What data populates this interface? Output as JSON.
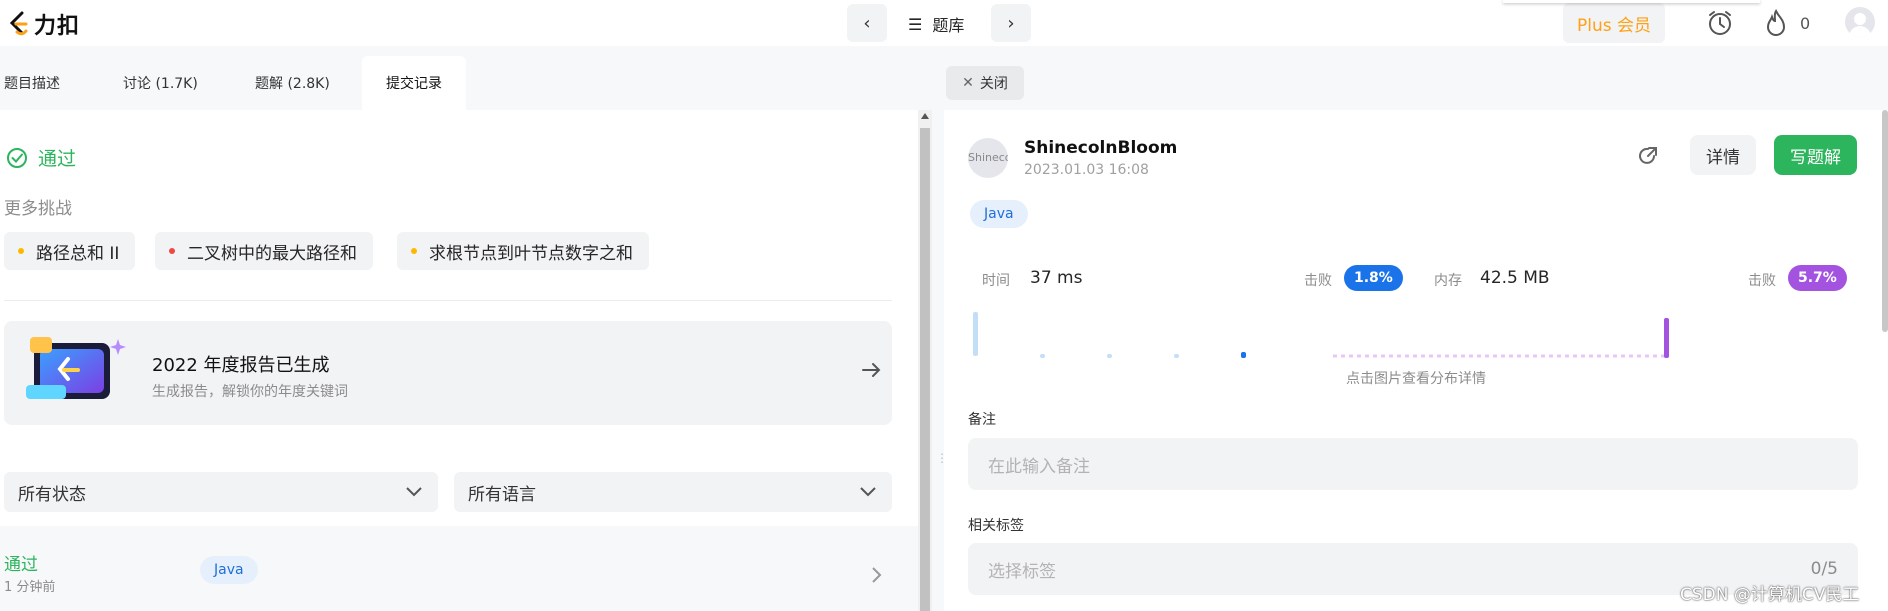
{
  "app": {
    "logo_text": "力扣"
  },
  "header": {
    "bank_label": "题库",
    "plus_label": "Plus 会员",
    "streak_count": "0"
  },
  "tabs": [
    {
      "label": "题目描述"
    },
    {
      "label": "讨论 (1.7K)"
    },
    {
      "label": "题解 (2.8K)"
    },
    {
      "label": "提交记录"
    }
  ],
  "result": {
    "status": "通过"
  },
  "challenges": {
    "title": "更多挑战",
    "items": [
      {
        "label": "路径总和 II",
        "color": "#ffb800"
      },
      {
        "label": "二叉树中的最大路径和",
        "color": "#ef4743"
      },
      {
        "label": "求根节点到叶节点数字之和",
        "color": "#ffb800"
      }
    ]
  },
  "report": {
    "title": "2022 年度报告已生成",
    "subtitle": "生成报告，解锁你的年度关键词"
  },
  "filters": {
    "status": "所有状态",
    "language": "所有语言"
  },
  "submission": {
    "status": "通过",
    "time": "1 分钟前",
    "language": "Java"
  },
  "panel": {
    "close_label": "关闭",
    "user": {
      "name": "ShinecolnBloom",
      "date": "2023.01.03 16:08",
      "avatar_alt": "Shinecoln"
    },
    "detail_label": "详情",
    "write_label": "写题解",
    "language": "Java",
    "runtime": {
      "label": "时间",
      "value": "37 ms",
      "beat_label": "击败",
      "beat": "1.8%",
      "beat_value": 1.8
    },
    "memory": {
      "label": "内存",
      "value": "42.5 MB",
      "beat_label": "击败",
      "beat": "5.7%",
      "beat_value": 5.7
    },
    "chart_hint": "点击图片查看分布详情",
    "note": {
      "label": "备注",
      "placeholder": "在此输入备注"
    },
    "tags": {
      "label": "相关标签",
      "placeholder": "选择标签",
      "count": "0/5"
    }
  },
  "colors": {
    "accent_green": "#2db55d",
    "plus_orange": "#ffa116",
    "runtime_blue": "#1a73e8",
    "memory_purple": "#a353e0"
  },
  "watermark": "CSDN @计算机CV民工"
}
